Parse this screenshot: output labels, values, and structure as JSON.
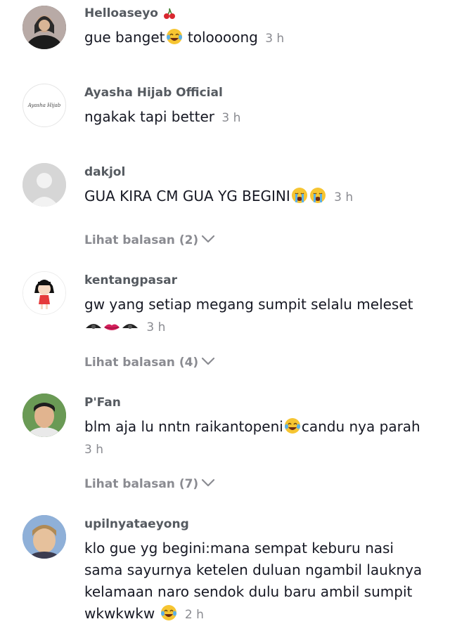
{
  "comments": [
    {
      "username": "Helloaseyo",
      "text_before": "gue banget",
      "text_after": " toloooong",
      "time": "3 h"
    },
    {
      "username": "Ayasha Hijab Official",
      "avatar_logo_text": "Ayasha Hijab",
      "text": "ngakak tapi better",
      "time": "3 h"
    },
    {
      "username": "dakjol",
      "text": "GUA KIRA CM GUA YG BEGINI",
      "time": "3 h",
      "replies": "Lihat balasan (2)"
    },
    {
      "username": "kentangpasar",
      "text_line1": "gw yang setiap megang sumpit selalu meleset",
      "time": "3 h",
      "replies": "Lihat balasan (4)"
    },
    {
      "username": "P'Fan",
      "text_before": "blm aja lu nntn raikantopeni",
      "text_after": "candu nya parah",
      "time": "3 h",
      "replies": "Lihat balasan (7)"
    },
    {
      "username": "upilnyataeyong",
      "lines": [
        "klo gue yg begini:mana sempat keburu nasi",
        "sama sayurnya ketelen duluan ngambil lauknya",
        "kelamaan naro sendok dulu baru ambil sumpit"
      ],
      "last_line": "wkwkwkw",
      "time": "2 h"
    }
  ],
  "colors": {
    "username": "#555a60",
    "text": "#161823",
    "meta": "#8a8b91"
  },
  "icons": [
    "cherry-icon",
    "tears-of-joy-emoji-icon",
    "crying-emoji-icon",
    "eye-icon",
    "lips-icon",
    "chevron-down-icon",
    "default-avatar-icon"
  ]
}
